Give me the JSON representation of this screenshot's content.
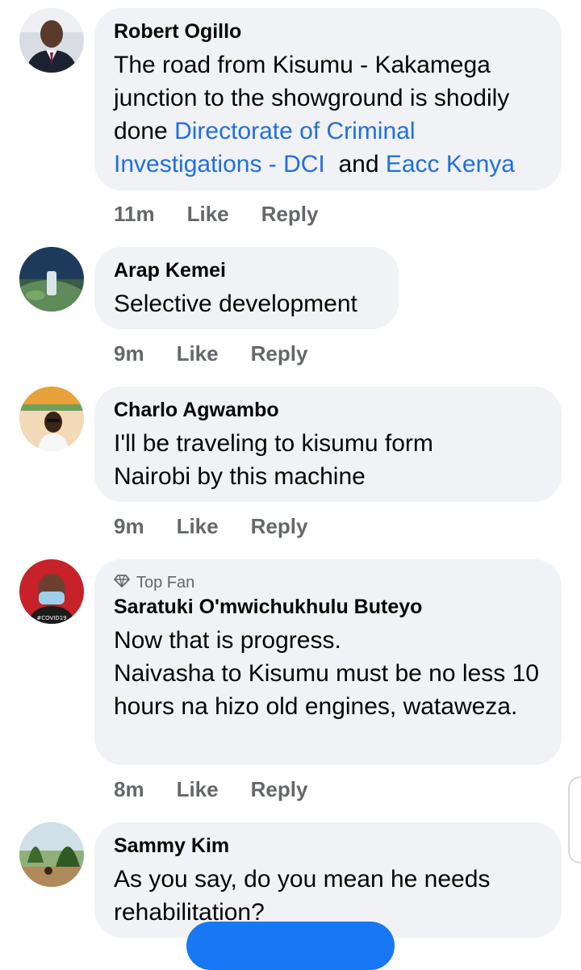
{
  "comments": [
    {
      "author": "Robert Ogillo",
      "text_parts": [
        "The road from Kisumu - Kakamega junction to the showground is shodily done ",
        "Directorate of Criminal Investigations - DCI",
        "  and ",
        "Eacc Kenya"
      ],
      "time": "11m",
      "like": "Like",
      "reply": "Reply"
    },
    {
      "author": "Arap Kemei",
      "text": "Selective development",
      "time": "9m",
      "like": "Like",
      "reply": "Reply"
    },
    {
      "author": "Charlo Agwambo",
      "text_lines": [
        "I'll be traveling to kisumu form",
        "Nairobi by this machine"
      ],
      "time": "9m",
      "like": "Like",
      "reply": "Reply"
    },
    {
      "badge": "Top Fan",
      "author": "Saratuki O'mwichukhulu Buteyo",
      "text_lines": [
        "Now that is progress.",
        "Naivasha to Kisumu must be no less 10 hours na hizo old engines, wataweza."
      ],
      "time": "8m",
      "like": "Like",
      "reply": "Reply"
    },
    {
      "author": "Sammy Kim",
      "text": "As you say, do you mean he needs rehabilitation?"
    }
  ],
  "avatar_text": "#COVID19",
  "colors": {
    "bubble": "#f0f2f5",
    "mention": "#216fdb",
    "meta": "#65676b",
    "fab": "#1877f2"
  }
}
